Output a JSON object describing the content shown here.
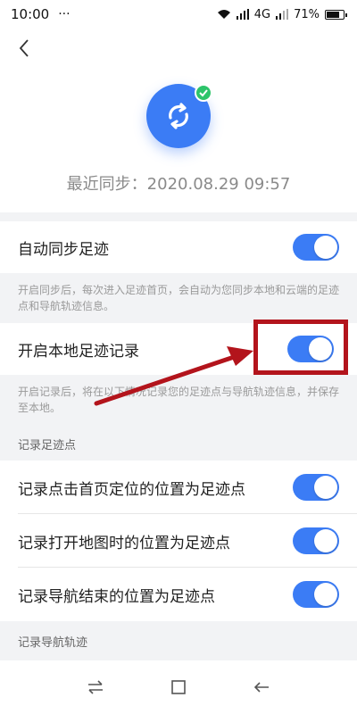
{
  "status_bar": {
    "time": "10:00",
    "dots": "···",
    "network": "4G",
    "battery": "71%"
  },
  "header": {
    "last_sync": "最近同步：2020.08.29  09:57"
  },
  "rows": [
    {
      "label": "自动同步足迹",
      "on": true
    },
    {
      "label": "开启本地足迹记录",
      "on": true
    }
  ],
  "descriptions": {
    "auto_sync": "开启同步后，每次进入足迹首页，会自动为您同步本地和云端的足迹点和导航轨迹信息。",
    "local_record": "开启记录后，将在以下情况记录您的足迹点与导航轨迹信息，并保存至本地。"
  },
  "sections": {
    "footprint_points": "记录足迹点",
    "nav_track": "记录导航轨迹"
  },
  "point_rows": [
    {
      "label": "记录点击首页定位的位置为足迹点",
      "on": true
    },
    {
      "label": "记录打开地图时的位置为足迹点",
      "on": true
    },
    {
      "label": "记录导航结束的位置为足迹点",
      "on": true
    }
  ],
  "colors": {
    "accent": "#3b7cf5",
    "check": "#2dc46a",
    "annotation": "#b3141c"
  },
  "icons": {
    "back": "chevron-left-icon",
    "sync": "sync-icon",
    "check": "check-icon"
  }
}
